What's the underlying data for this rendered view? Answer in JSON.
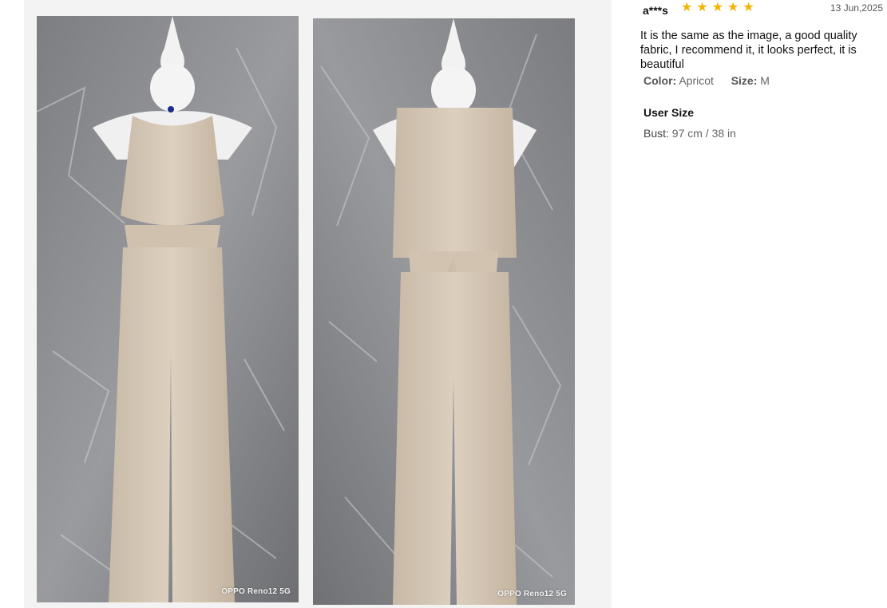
{
  "gallery": {
    "photos": [
      {
        "watermark": "OPPO Reno12 5G",
        "subject": "jumpsuit-front"
      },
      {
        "watermark": "OPPO Reno12 5G",
        "subject": "jumpsuit-back"
      }
    ]
  },
  "review": {
    "reviewer": "a***s",
    "rating": 5,
    "stars": [
      "★",
      "★",
      "★",
      "★",
      "★"
    ],
    "star_color": "#f5b301",
    "date": "13 Jun,2025",
    "text": "It is the same as the image, a good quality fabric, I recommend it, it looks perfect, it is beautiful",
    "color_label": "Color:",
    "color_value": "Apricot",
    "size_label": "Size:",
    "size_value": "M",
    "user_size_title": "User Size",
    "bust_label": "Bust:",
    "bust_value": "97 cm / 38 in"
  }
}
